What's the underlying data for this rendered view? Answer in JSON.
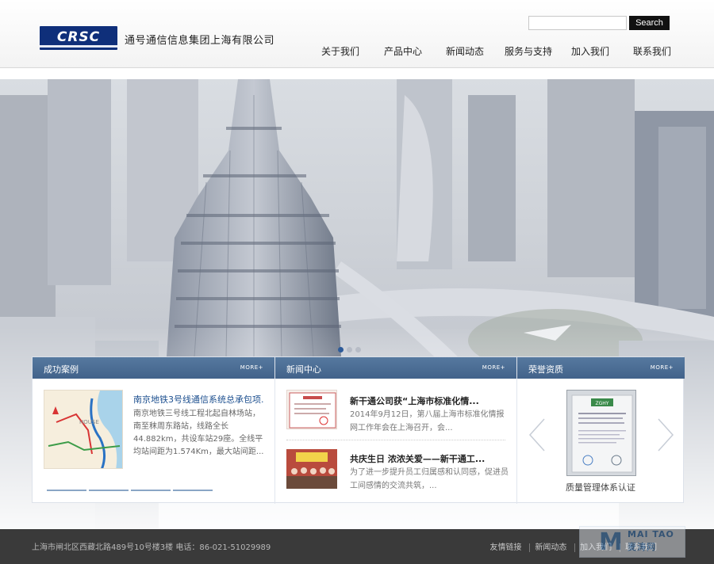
{
  "header": {
    "logo_text": "CRSC",
    "company_name": "通号通信信息集团上海有限公司",
    "search_placeholder": "",
    "search_label": "Search"
  },
  "nav": [
    {
      "label": "关于我们"
    },
    {
      "label": "产品中心"
    },
    {
      "label": "新闻动态"
    },
    {
      "label": "服务与支持"
    },
    {
      "label": "加入我们"
    },
    {
      "label": "联系我们"
    }
  ],
  "banner": {
    "slide_count": 3,
    "active_slide": 1
  },
  "panels": {
    "cases": {
      "title": "成功案例",
      "more": "MORE+",
      "item_title": "南京地铁3号线通信系统总承包项...",
      "item_desc": "南京地铁三号线工程北起自林场站，南至秣周东路站，线路全长44.882km，共设车站29座。全线平均站间距为1.574Km，最大站间距...",
      "map_label": "HOUSE"
    },
    "news": {
      "title": "新闻中心",
      "more": "MORE+",
      "items": [
        {
          "title": "新干通公司获“上海市标准化情...",
          "desc": "2014年9月12日，第八届上海市标准化情报网工作年会在上海召开，会..."
        },
        {
          "title": "共庆生日 浓浓关爱——新干通工...",
          "desc": "为了进一步提升员工归属感和认同感，促进员工间感情的交流共筑，..."
        }
      ]
    },
    "honors": {
      "title": "荣誉资质",
      "more": "MORE+",
      "caption": "质量管理体系认证",
      "prev_icon": "chevron-left-icon",
      "next_icon": "chevron-right-icon",
      "cert_badge": "ZGHY"
    }
  },
  "footer": {
    "address": "上海市闸北区西藏北路489号10号楼3楼 电话：86-021-51029989",
    "links": [
      "友情链接",
      "新闻动态",
      "加入我们",
      "联系我们"
    ]
  },
  "watermark": {
    "line1": "MAI TAO",
    "line2": "麦涛网"
  },
  "colors": {
    "brand_navy": "#0f2f7a",
    "panel_header": "#4b6d94",
    "link_blue": "#1c4f8f",
    "footer_bg": "#3a3a3a"
  }
}
